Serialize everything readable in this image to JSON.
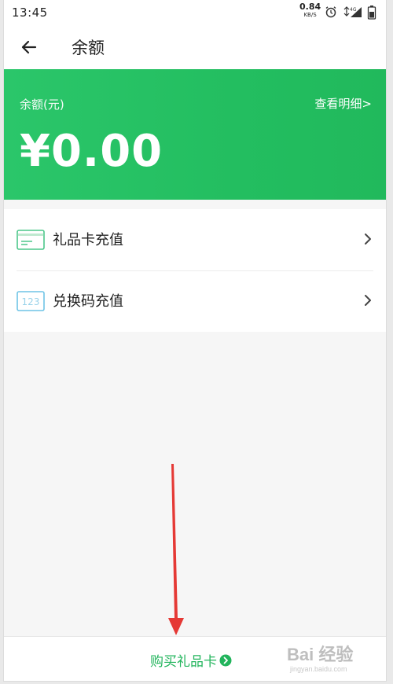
{
  "status_bar": {
    "time": "13:45",
    "speed_value": "0.84",
    "speed_unit": "KB/S",
    "network_label": "4G"
  },
  "header": {
    "title": "余额"
  },
  "balance": {
    "label": "余额(元)",
    "detail_link": "查看明细>",
    "amount": "¥0.00"
  },
  "menu": {
    "items": [
      {
        "label": "礼品卡充值",
        "icon": "gift-card-icon"
      },
      {
        "label": "兑换码充值",
        "icon": "redeem-code-icon",
        "icon_text": "123"
      }
    ]
  },
  "bottom_bar": {
    "buy_label": "购买礼品卡"
  },
  "watermark": {
    "text": "Bai 经验",
    "sub": "jingyan.baidu.com"
  },
  "colors": {
    "brand_green": "#23be60",
    "annotation_red": "#e53935"
  }
}
